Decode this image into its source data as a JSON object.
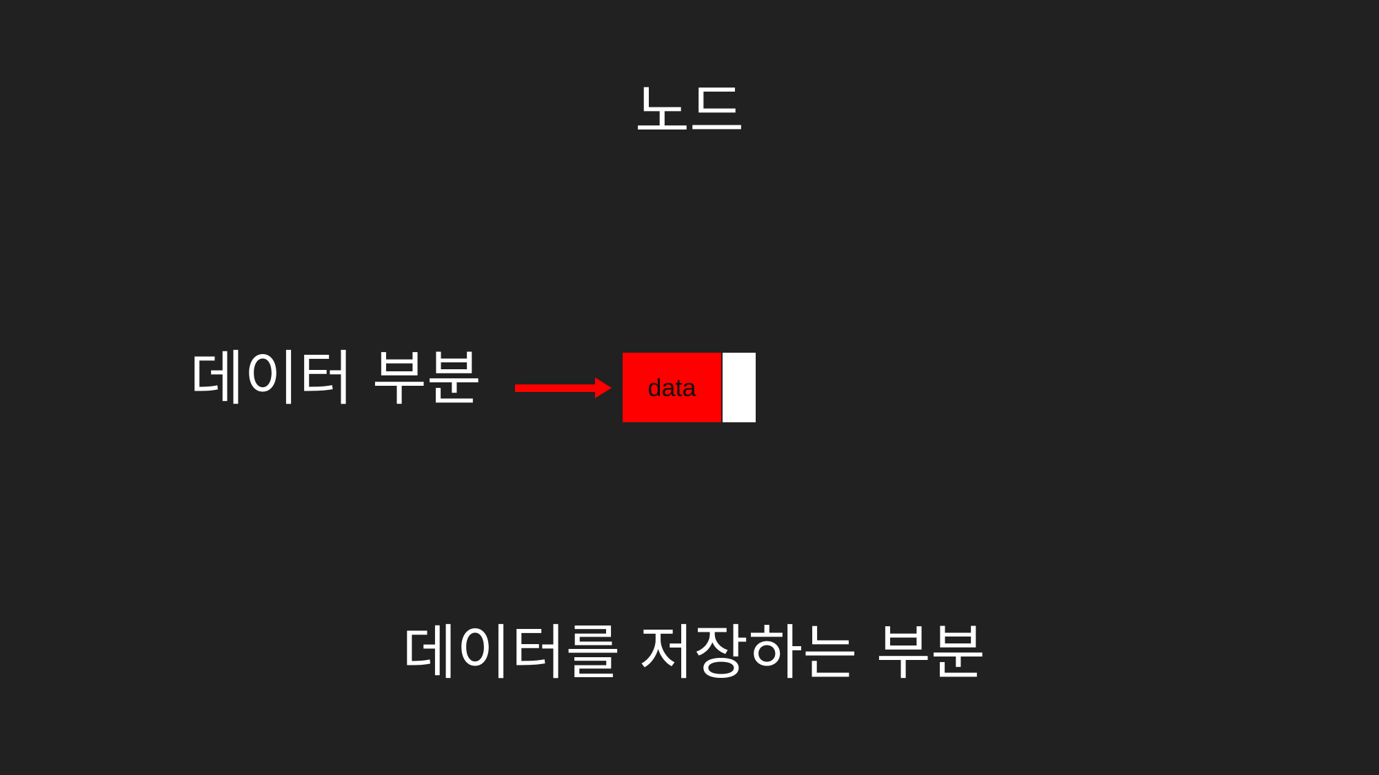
{
  "slide": {
    "title": "노드",
    "label": "데이터 부분",
    "description": "데이터를 저장하는 부분"
  },
  "node": {
    "data_label": "data"
  },
  "colors": {
    "background": "#212121",
    "text": "#ffffff",
    "accent": "#ff0000",
    "link_part": "#ffffff"
  }
}
